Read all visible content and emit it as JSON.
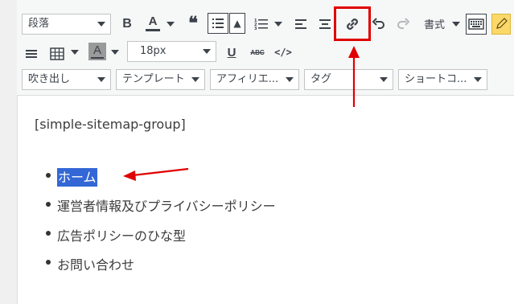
{
  "colors": {
    "accent_red": "#e00000",
    "selection": "#3367d6"
  },
  "toolbar": {
    "row1": {
      "format_select": "段落",
      "bold": "B",
      "text_color": "A",
      "quote": "❝",
      "align_toggle": "▲",
      "style_menu": "書式"
    },
    "row2": {
      "bg_color": "A",
      "font_size": "18px",
      "underline": "U",
      "strike": "ABC",
      "code": "</>"
    },
    "row3": {
      "balloon": "吹き出し",
      "template": "テンプレート",
      "affiliate": "アフィリエ...",
      "tag": "タグ",
      "shortcode": "ショートコ..."
    }
  },
  "editor": {
    "shortcode": "[simple-sitemap-group]",
    "items": [
      "ホーム",
      "運営者情報及びプライバシーポリシー",
      "広告ポリシーのひな型",
      "お問い合わせ"
    ]
  },
  "icons": [
    "bold-icon",
    "text-color-icon",
    "blockquote-icon",
    "bullet-list-icon",
    "numbered-list-icon",
    "align-left-icon",
    "align-center-icon",
    "link-icon",
    "undo-icon",
    "redo-icon",
    "keyboard-icon",
    "edit-icon",
    "horizontal-rule-icon",
    "table-icon",
    "underline-icon",
    "strikethrough-icon",
    "code-icon"
  ]
}
